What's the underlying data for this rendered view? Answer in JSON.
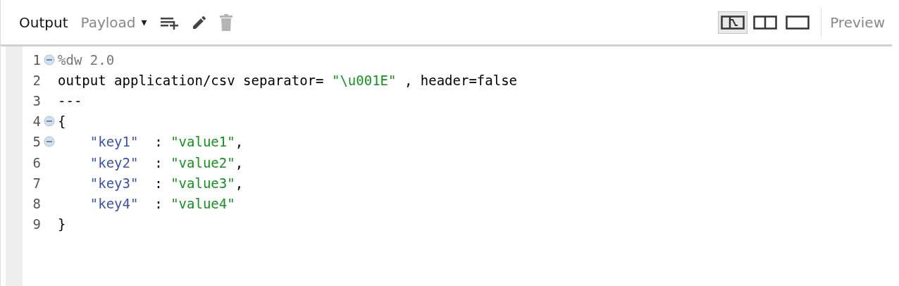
{
  "toolbar": {
    "title": "Output",
    "payload_menu": {
      "label": "Payload",
      "caret": "▾"
    },
    "actions": [
      {
        "kind": "add-list",
        "disabled": false
      },
      {
        "kind": "edit",
        "disabled": false
      },
      {
        "kind": "delete",
        "disabled": true
      }
    ],
    "view_modes": [
      {
        "kind": "split-linked",
        "selected": true
      },
      {
        "kind": "split",
        "selected": false
      },
      {
        "kind": "single",
        "selected": false
      }
    ],
    "preview": "Preview"
  },
  "editor": {
    "lines": [
      {
        "number": "1",
        "foldable": true,
        "tokens": [
          {
            "kind": "directive",
            "text": "%dw 2.0"
          }
        ]
      },
      {
        "number": "2",
        "foldable": false,
        "tokens": [
          {
            "kind": "plain",
            "text": "output application/csv separator= "
          },
          {
            "kind": "string",
            "text": "\"\\u001E\""
          },
          {
            "kind": "plain",
            "text": " , header=false"
          }
        ]
      },
      {
        "number": "3",
        "foldable": false,
        "tokens": [
          {
            "kind": "plain",
            "text": "---"
          }
        ]
      },
      {
        "number": "4",
        "foldable": true,
        "tokens": [
          {
            "kind": "plain",
            "text": "{"
          }
        ]
      },
      {
        "number": "5",
        "foldable": true,
        "tokens": [
          {
            "kind": "key",
            "text": "    \"key1\""
          },
          {
            "kind": "plain",
            "text": "  : "
          },
          {
            "kind": "string",
            "text": "\"value1\""
          },
          {
            "kind": "plain",
            "text": ","
          }
        ]
      },
      {
        "number": "6",
        "foldable": false,
        "tokens": [
          {
            "kind": "key",
            "text": "    \"key2\""
          },
          {
            "kind": "plain",
            "text": "  : "
          },
          {
            "kind": "string",
            "text": "\"value2\""
          },
          {
            "kind": "plain",
            "text": ","
          }
        ]
      },
      {
        "number": "7",
        "foldable": false,
        "tokens": [
          {
            "kind": "key",
            "text": "    \"key3\""
          },
          {
            "kind": "plain",
            "text": "  : "
          },
          {
            "kind": "string",
            "text": "\"value3\""
          },
          {
            "kind": "plain",
            "text": ","
          }
        ]
      },
      {
        "number": "8",
        "foldable": false,
        "tokens": [
          {
            "kind": "key",
            "text": "    \"key4\""
          },
          {
            "kind": "plain",
            "text": "  : "
          },
          {
            "kind": "string",
            "text": "\"value4\""
          }
        ]
      },
      {
        "number": "9",
        "foldable": false,
        "tokens": [
          {
            "kind": "plain",
            "text": "}"
          }
        ]
      }
    ]
  }
}
